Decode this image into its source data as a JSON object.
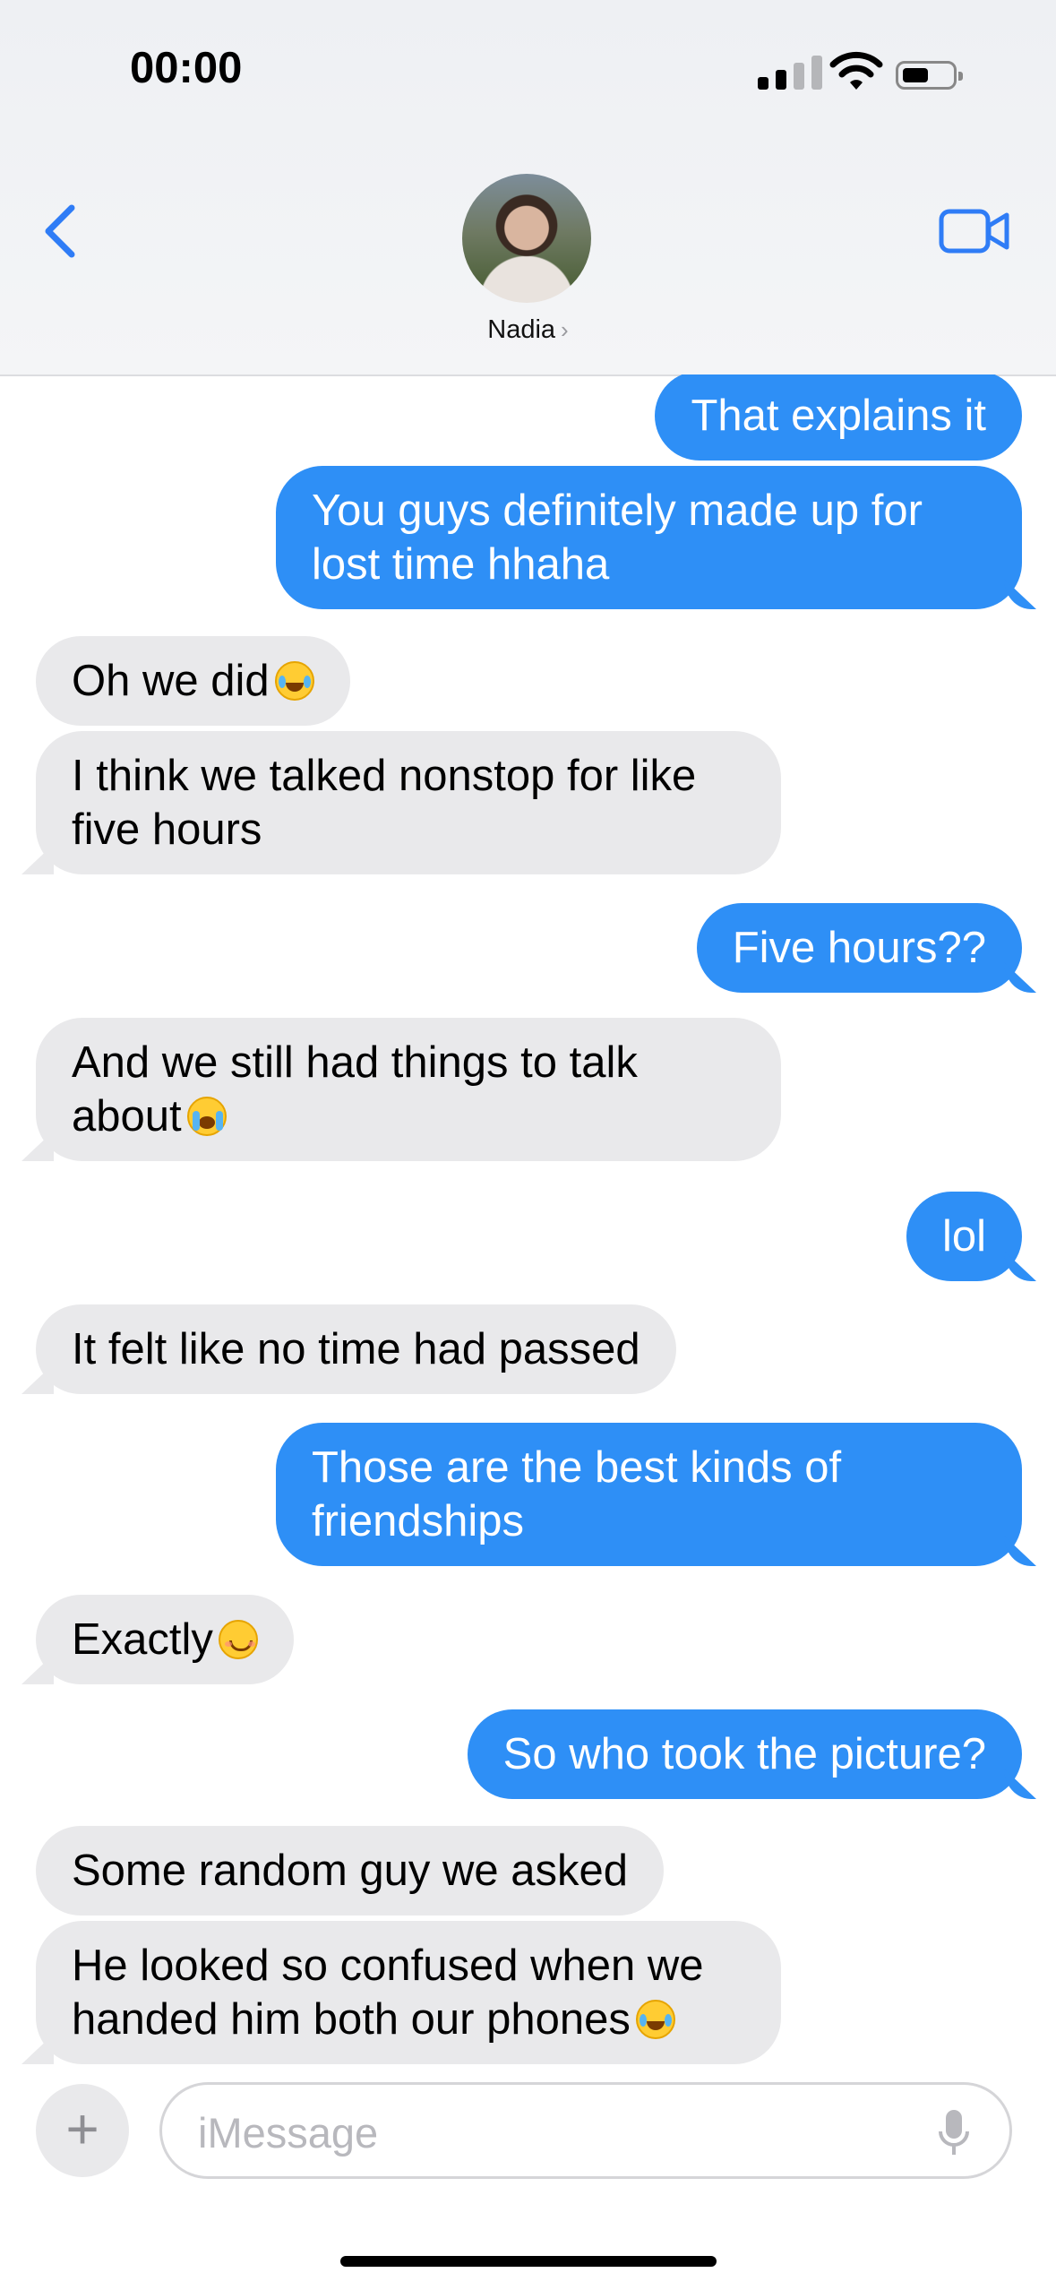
{
  "status_bar": {
    "time": "00:00"
  },
  "header": {
    "contact_name": "Nadia",
    "chevron": "›"
  },
  "messages": [
    {
      "dir": "out",
      "text": "That explains it"
    },
    {
      "dir": "out",
      "text": "You guys definitely made up for\nlost time hhaha"
    },
    {
      "dir": "in",
      "text": "Oh we did",
      "emoji": "laugh"
    },
    {
      "dir": "in",
      "text": "I think we talked nonstop for like\nfive hours"
    },
    {
      "dir": "out",
      "text": "Five hours??"
    },
    {
      "dir": "in",
      "text": "And we still had things to talk\nabout",
      "emoji": "cry"
    },
    {
      "dir": "out",
      "text": "lol"
    },
    {
      "dir": "in",
      "text": "It felt like no time had passed"
    },
    {
      "dir": "out",
      "text": "Those are the best kinds of\nfriendships"
    },
    {
      "dir": "in",
      "text": "Exactly",
      "emoji": "smile"
    },
    {
      "dir": "out",
      "text": "So who took the picture?"
    },
    {
      "dir": "in",
      "text": "Some random guy we asked"
    },
    {
      "dir": "in",
      "text": "He looked so confused when we\nhanded him both our phones",
      "emoji": "laugh"
    }
  ],
  "composer": {
    "placeholder": "iMessage",
    "plus": "+"
  },
  "icons": [
    "back-chevron-icon",
    "video-call-icon",
    "mic-icon",
    "plus-icon",
    "signal-icon",
    "wifi-icon",
    "battery-icon"
  ],
  "colors": {
    "outgoing": "#2e8ff6",
    "incoming": "#e9e9eb",
    "accent": "#2f7cf6"
  }
}
